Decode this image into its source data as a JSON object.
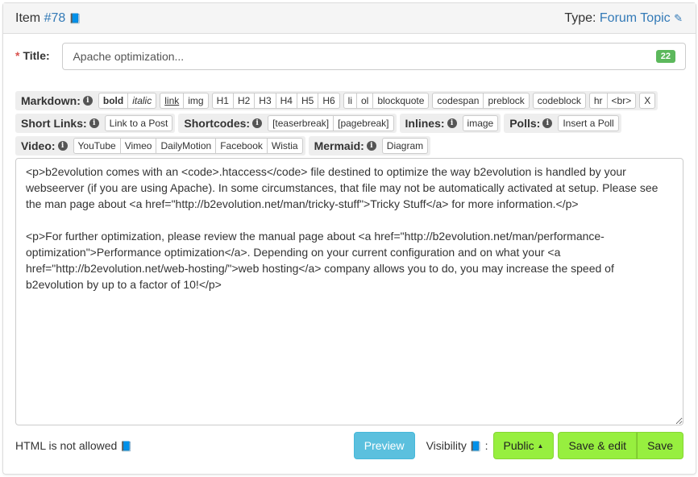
{
  "header": {
    "item_label": "Item",
    "item_number": "#78",
    "type_label": "Type:",
    "type_value": "Forum Topic"
  },
  "title": {
    "required_mark": "*",
    "label": "Title:",
    "value": "Apache optimization...",
    "char_count": "22"
  },
  "toolbar": {
    "markdown": {
      "label": "Markdown:",
      "groups": [
        [
          "bold",
          "italic"
        ],
        [
          "link",
          "img"
        ],
        [
          "H1",
          "H2",
          "H3",
          "H4",
          "H5",
          "H6"
        ],
        [
          "li",
          "ol",
          "blockquote"
        ],
        [
          "codespan",
          "preblock"
        ],
        [
          "codeblock"
        ],
        [
          "hr",
          "<br>"
        ],
        [
          "X"
        ]
      ]
    },
    "short_links": {
      "label": "Short Links:",
      "buttons": [
        "Link to a Post"
      ]
    },
    "shortcodes": {
      "label": "Shortcodes:",
      "buttons": [
        "[teaserbreak]",
        "[pagebreak]"
      ]
    },
    "inlines": {
      "label": "Inlines:",
      "buttons": [
        "image"
      ]
    },
    "polls": {
      "label": "Polls:",
      "buttons": [
        "Insert a Poll"
      ]
    },
    "video": {
      "label": "Video:",
      "buttons": [
        "YouTube",
        "Vimeo",
        "DailyMotion",
        "Facebook",
        "Wistia"
      ]
    },
    "mermaid": {
      "label": "Mermaid:",
      "buttons": [
        "Diagram"
      ]
    }
  },
  "content": "<p>b2evolution comes with an <code>.htaccess</code> file destined to optimize the way b2evolution is handled by your webseerver (if you are using Apache). In some circumstances, that file may not be automatically activated at setup. Please see the man page about <a href=\"http://b2evolution.net/man/tricky-stuff\">Tricky Stuff</a> for more information.</p>\n\n<p>For further optimization, please review the manual page about <a href=\"http://b2evolution.net/man/performance-optimization\">Performance optimization</a>. Depending on your current configuration and on what your <a href=\"http://b2evolution.net/web-hosting/\">web hosting</a> company allows you to do, you may increase the speed of b2evolution by up to a factor of 10!</p>",
  "footer": {
    "html_note": "HTML is not allowed",
    "preview": "Preview",
    "visibility_label": "Visibility",
    "visibility_colon": ":",
    "visibility_value": "Public",
    "save_edit": "Save & edit",
    "save": "Save"
  },
  "colors": {
    "accent": "#337ab7",
    "save_green": "#97ef3f",
    "preview_blue": "#5bc0de"
  }
}
